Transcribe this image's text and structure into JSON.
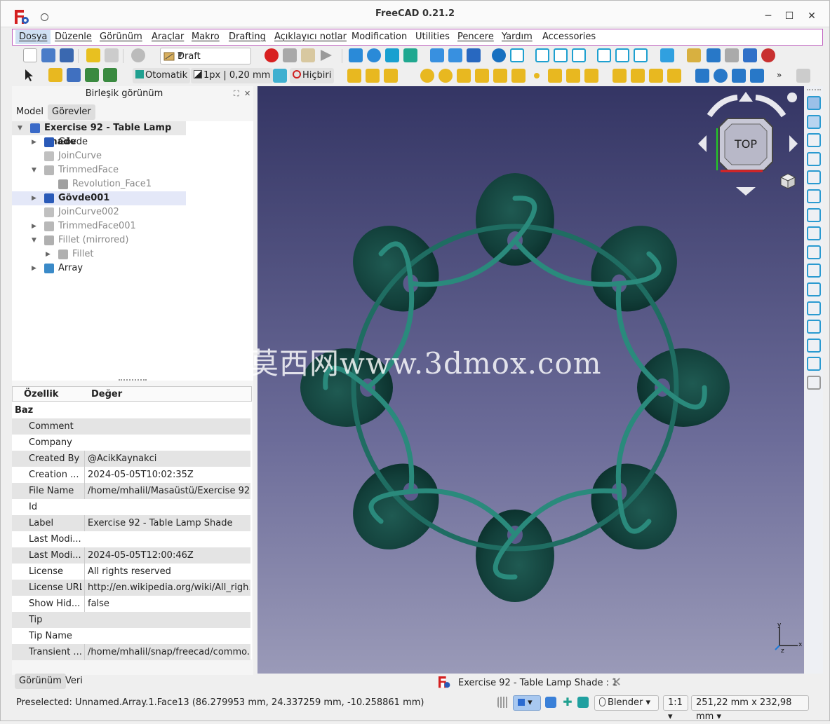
{
  "window": {
    "title": "FreeCAD 0.21.2"
  },
  "menu": [
    "Dosya",
    "Düzenle",
    "Görünüm",
    "Araçlar",
    "Makro",
    "Drafting",
    "Açıklayıcı notlar",
    "Modification",
    "Utilities",
    "Pencere",
    "Yardım",
    "Accessories"
  ],
  "toolbar": {
    "workbench": "Draft",
    "snap_mode": "Otomatik",
    "line_style": "1px | 0,20 mm",
    "construction": "Hiçbiri"
  },
  "combo_view": {
    "title": "Birleşik görünüm",
    "tabs": [
      "Model",
      "Görevler"
    ],
    "tree": [
      {
        "label": "Exercise 92 - Table Lamp Shade",
        "level": 0,
        "arrow": "down",
        "icon": "document-icon",
        "bold": true
      },
      {
        "label": "Gövde",
        "level": 1,
        "arrow": "right",
        "icon": "body-icon"
      },
      {
        "label": "JoinCurve",
        "level": 1,
        "arrow": "",
        "icon": "curve-icon",
        "grey": true
      },
      {
        "label": "TrimmedFace",
        "level": 1,
        "arrow": "down",
        "icon": "face-icon",
        "grey": true
      },
      {
        "label": "Revolution_Face1",
        "level": 2,
        "arrow": "",
        "icon": "solid-icon",
        "grey": true
      },
      {
        "label": "Gövde001",
        "level": 1,
        "arrow": "right",
        "icon": "body-icon",
        "bold": true,
        "selected": true
      },
      {
        "label": "JoinCurve002",
        "level": 1,
        "arrow": "",
        "icon": "curve-icon",
        "grey": true
      },
      {
        "label": "TrimmedFace001",
        "level": 1,
        "arrow": "right",
        "icon": "face-icon",
        "grey": true
      },
      {
        "label": "Fillet (mirrored)",
        "level": 1,
        "arrow": "down",
        "icon": "mirror-icon",
        "grey": true
      },
      {
        "label": "Fillet",
        "level": 2,
        "arrow": "right",
        "icon": "fillet-icon",
        "grey": true
      },
      {
        "label": "Array",
        "level": 1,
        "arrow": "right",
        "icon": "array-icon"
      }
    ],
    "property_header": {
      "name": "Özellik",
      "value": "Değer"
    },
    "property_group": "Baz",
    "properties": [
      {
        "name": "Comment",
        "value": ""
      },
      {
        "name": "Company",
        "value": ""
      },
      {
        "name": "Created By",
        "value": "@AcikKaynakci"
      },
      {
        "name": "Creation ...",
        "value": "2024-05-05T10:02:35Z"
      },
      {
        "name": "File Name",
        "value": "/home/mhalil/Masaüstü/Exercise 92 ..."
      },
      {
        "name": "Id",
        "value": ""
      },
      {
        "name": "Label",
        "value": "Exercise 92 - Table Lamp Shade"
      },
      {
        "name": "Last Modi...",
        "value": ""
      },
      {
        "name": "Last Modi...",
        "value": "2024-05-05T12:00:46Z"
      },
      {
        "name": "License",
        "value": "All rights reserved"
      },
      {
        "name": "License URL",
        "value": "http://en.wikipedia.org/wiki/All_righ..."
      },
      {
        "name": "Show Hid...",
        "value": "false"
      },
      {
        "name": "Tip",
        "value": ""
      },
      {
        "name": "Tip Name",
        "value": ""
      },
      {
        "name": "Transient ...",
        "value": "/home/mhalil/snap/freecad/commo..."
      }
    ],
    "bottom_tabs": [
      "Görünüm",
      "Veri"
    ]
  },
  "navcube": {
    "face": "TOP"
  },
  "axis": {
    "x": "x",
    "y": "y",
    "z": "z"
  },
  "watermark": "莫西网www.3dmox.com",
  "document_tab": "Exercise 92 - Table Lamp Shade : 1",
  "status": {
    "message": "Preselected: Unnamed.Array.1.Face13 (86.279953 mm, 24.337259 mm, -10.258861 mm)",
    "nav_style": "Blender",
    "scale": "1:1",
    "dimensions": "251,22 mm x 232,98 mm"
  },
  "colors": {
    "shade": "#123f3a",
    "tube": "#2a8a7c",
    "menu_border": "#c060c0",
    "viewport_top": "#343564",
    "viewport_bottom": "#9a9ab8"
  }
}
